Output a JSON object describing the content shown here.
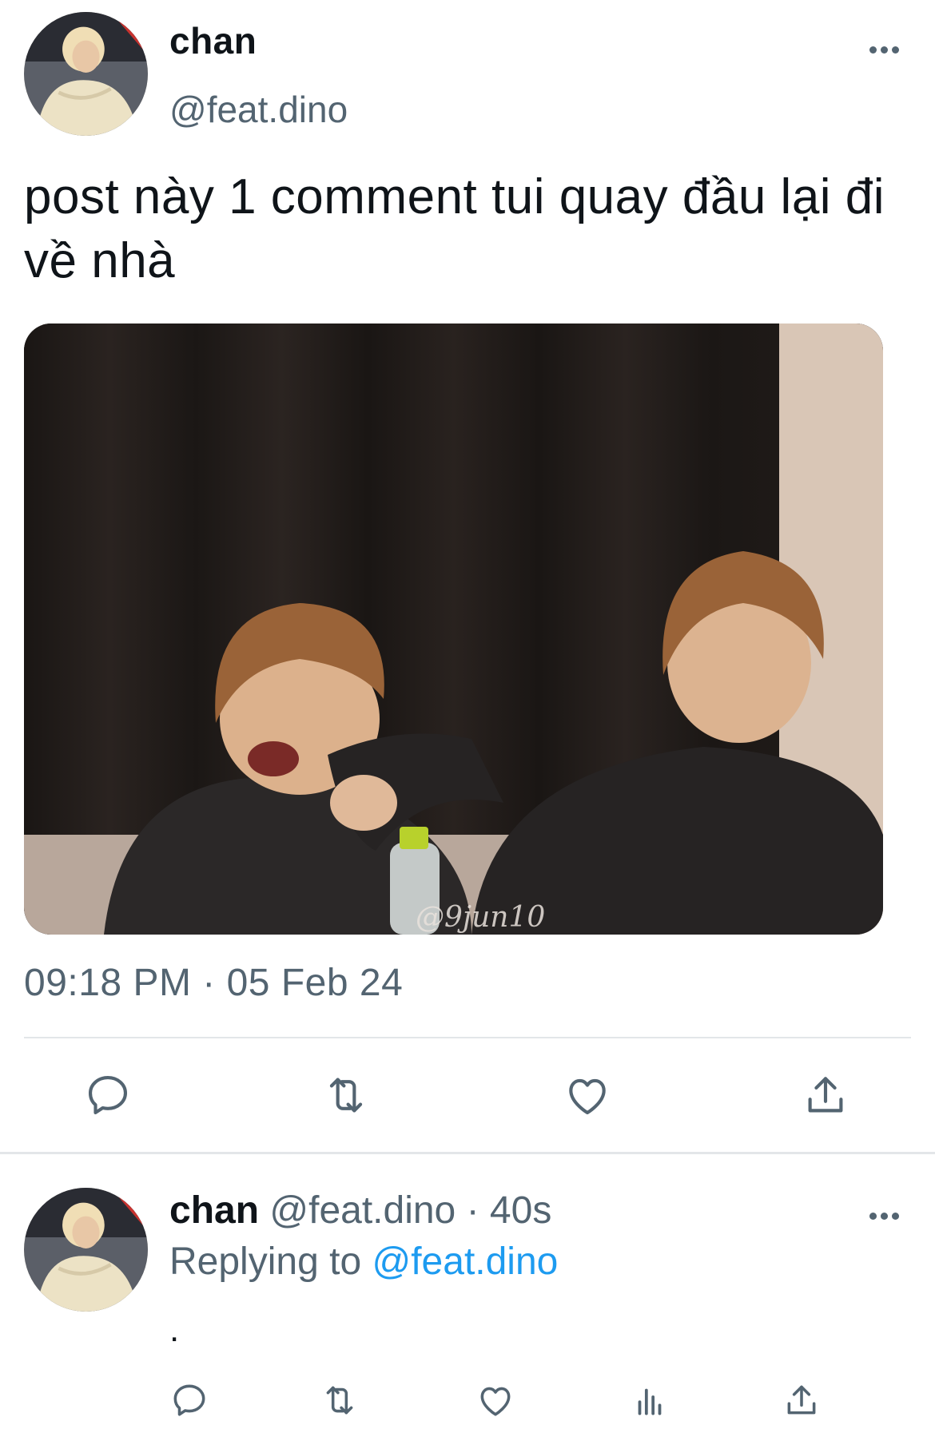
{
  "tweet": {
    "author": {
      "name": "chan",
      "handle": "@feat.dino",
      "avatar_icon": "profile-photo"
    },
    "text": "post này 1 comment tui quay đầu lại đi về nhà",
    "image": {
      "watermark": "@9jun10",
      "description_icon": "photo-two-people"
    },
    "timestamp": "09:18 PM · 05 Feb 24",
    "actions": [
      "reply-icon",
      "retweet-icon",
      "like-icon",
      "share-icon"
    ],
    "more_icon": "more-icon"
  },
  "reply": {
    "author": {
      "name": "chan",
      "handle": "@feat.dino"
    },
    "separator": "·",
    "time": "40s",
    "replying_prefix": "Replying to",
    "replying_to": "@feat.dino",
    "text": ".",
    "actions": [
      "reply-icon",
      "retweet-icon",
      "like-icon",
      "analytics-icon",
      "share-icon"
    ]
  },
  "colors": {
    "text": "#0f1419",
    "secondary": "#536471",
    "link": "#1d9bf0",
    "divider": "#e3e6e9"
  }
}
